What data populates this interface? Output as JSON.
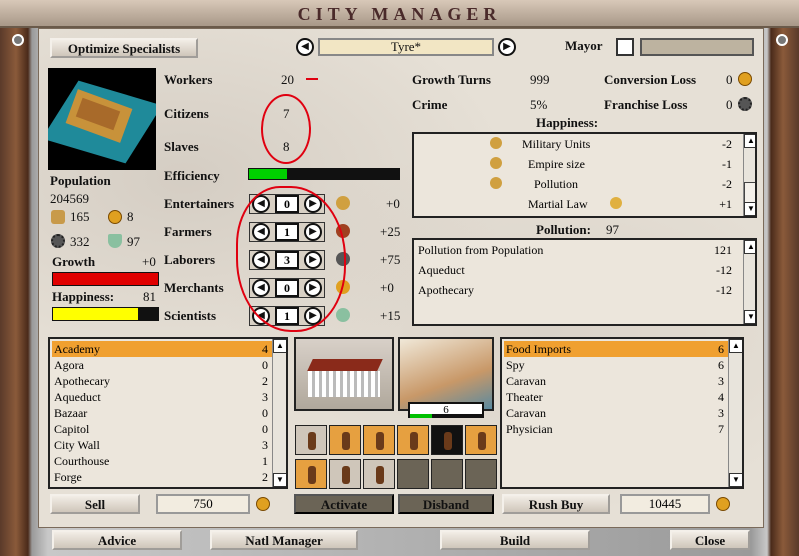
{
  "window": {
    "title": "CITY MANAGER"
  },
  "top": {
    "optimize_label": "Optimize Specialists",
    "city_name": "Tyre*",
    "mayor_label": "Mayor"
  },
  "stats": {
    "workers_label": "Workers",
    "workers_value": "20",
    "citizens_label": "Citizens",
    "citizens_value": "7",
    "slaves_label": "Slaves",
    "slaves_value": "8",
    "efficiency_label": "Efficiency",
    "population_label": "Population",
    "population_value": "204569",
    "food_value": "165",
    "gold_value": "8",
    "production_value": "332",
    "science_value": "97",
    "growth_label": "Growth",
    "growth_value": "+0",
    "happiness_label": "Happiness:",
    "happiness_value": "81",
    "efficiency_fill": 0.25,
    "growth_fill": 1.0,
    "happiness_fill": 0.81
  },
  "specialists": [
    {
      "label": "Entertainers",
      "count": "0",
      "effect": "+0"
    },
    {
      "label": "Farmers",
      "count": "1",
      "effect": "+25"
    },
    {
      "label": "Laborers",
      "count": "3",
      "effect": "+75"
    },
    {
      "label": "Merchants",
      "count": "0",
      "effect": "+0"
    },
    {
      "label": "Scientists",
      "count": "1",
      "effect": "+15"
    }
  ],
  "right_stats": {
    "growth_turns_label": "Growth Turns",
    "growth_turns_value": "999",
    "conversion_loss_label": "Conversion Loss",
    "conversion_loss_value": "0",
    "crime_label": "Crime",
    "crime_value": "5%",
    "franchise_loss_label": "Franchise Loss",
    "franchise_loss_value": "0",
    "happiness_header": "Happiness:",
    "pollution_header": "Pollution:",
    "pollution_value": "97"
  },
  "happiness_rows": [
    {
      "label": "Military Units",
      "value": "-2"
    },
    {
      "label": "Empire size",
      "value": "-1"
    },
    {
      "label": "Pollution",
      "value": "-2"
    },
    {
      "label": "Martial Law",
      "value": "+1"
    }
  ],
  "pollution_rows": [
    {
      "label": "Pollution from Population",
      "value": "121"
    },
    {
      "label": "Aqueduct",
      "value": "-12"
    },
    {
      "label": "Apothecary",
      "value": "-12"
    }
  ],
  "build_list": [
    {
      "label": "Academy",
      "value": "4"
    },
    {
      "label": "Agora",
      "value": "0"
    },
    {
      "label": "Apothecary",
      "value": "2"
    },
    {
      "label": "Aqueduct",
      "value": "3"
    },
    {
      "label": "Bazaar",
      "value": "0"
    },
    {
      "label": "Capitol",
      "value": "0"
    },
    {
      "label": "City Wall",
      "value": "3"
    },
    {
      "label": "Courthouse",
      "value": "1"
    },
    {
      "label": "Forge",
      "value": "2"
    }
  ],
  "queue_list": [
    {
      "label": "Food Imports",
      "value": "6"
    },
    {
      "label": "Spy",
      "value": "6"
    },
    {
      "label": "Caravan",
      "value": "3"
    },
    {
      "label": "Theater",
      "value": "4"
    },
    {
      "label": "Caravan",
      "value": "3"
    },
    {
      "label": "Physician",
      "value": "7"
    }
  ],
  "center": {
    "turns_value": "6",
    "activate_label": "Activate",
    "disband_label": "Disband"
  },
  "bottom": {
    "sell_label": "Sell",
    "sell_value": "750",
    "rushbuy_label": "Rush Buy",
    "rushbuy_value": "10445",
    "advice_label": "Advice",
    "natl_label": "Natl Manager",
    "build_label": "Build",
    "close_label": "Close"
  },
  "colors": {
    "selection": "#f0a030",
    "growth_bar": "#e00000",
    "happiness_bar": "#ffff00",
    "efficiency_bar": "#00d000",
    "annotation": "#e00010"
  }
}
